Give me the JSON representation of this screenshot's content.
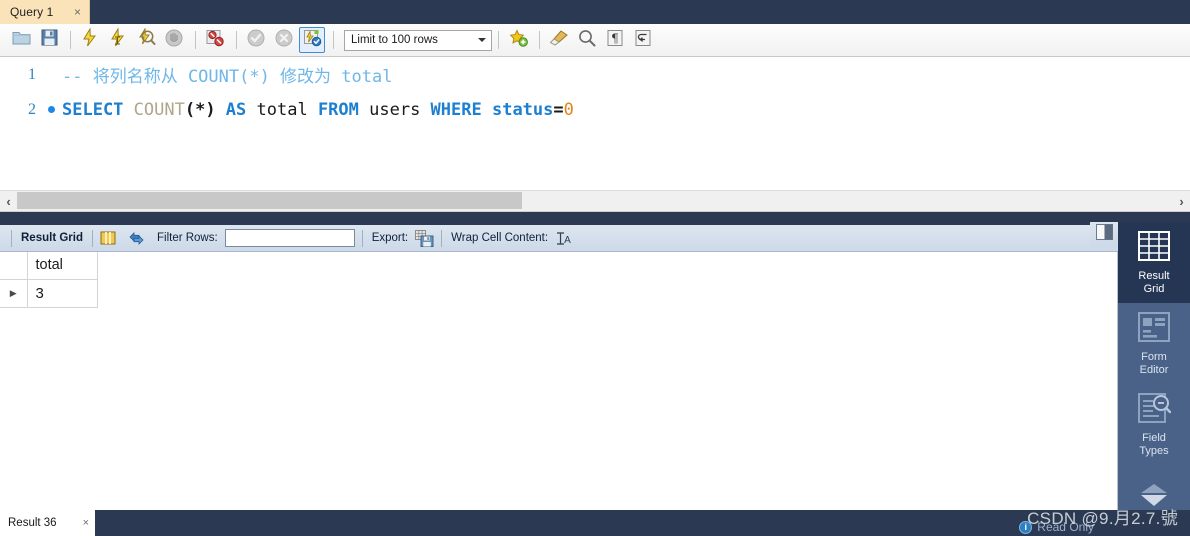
{
  "window": {
    "title": "Query 1"
  },
  "tabbar": {
    "tabs": [
      {
        "label": "Query 1",
        "close": "×",
        "active": true
      }
    ]
  },
  "toolbar": {
    "buttons": [
      {
        "name": "open-script-icon",
        "title": "Open SQL Script"
      },
      {
        "name": "save-script-icon",
        "title": "Save SQL Script"
      },
      {
        "name": "execute-statement-icon",
        "title": "Execute"
      },
      {
        "name": "execute-current-statement-icon",
        "title": "Execute Current Statement"
      },
      {
        "name": "explain-query-icon",
        "title": "Explain Current Statement"
      },
      {
        "name": "stop-execution-icon",
        "title": "Stop"
      },
      {
        "name": "toggle-stop-on-error-icon",
        "title": "Toggle whether execution should stop on error"
      },
      {
        "name": "commit-icon",
        "title": "Commit"
      },
      {
        "name": "rollback-icon",
        "title": "Rollback"
      },
      {
        "name": "autocommit-icon",
        "title": "Toggle Autocommit"
      },
      {
        "name": "add-snippet-icon",
        "title": "Save snippet"
      },
      {
        "name": "beautify-sql-icon",
        "title": "Beautify SQL"
      },
      {
        "name": "find-icon",
        "title": "Find"
      },
      {
        "name": "toggle-invisible-chars-icon",
        "title": "Toggle invisible characters"
      },
      {
        "name": "toggle-wrapping-icon",
        "title": "Toggle wrapping"
      }
    ],
    "limit_select": {
      "value": "Limit to 100 rows",
      "arrow": "▼"
    }
  },
  "editor": {
    "lines": [
      {
        "number": "1",
        "has_bullet": false,
        "tokens": [
          {
            "text": "-- 将列名称从 COUNT(*) 修改为 total",
            "cls": "c-comment"
          }
        ]
      },
      {
        "number": "2",
        "has_bullet": true,
        "tokens": [
          {
            "text": "SELECT ",
            "cls": "c-kw"
          },
          {
            "text": "COUNT",
            "cls": "c-fn"
          },
          {
            "text": "(*)",
            "cls": "c-op"
          },
          {
            "text": " AS ",
            "cls": "c-kw"
          },
          {
            "text": "total ",
            "cls": "c-plain"
          },
          {
            "text": "FROM ",
            "cls": "c-kw"
          },
          {
            "text": "users ",
            "cls": "c-plain"
          },
          {
            "text": "WHERE ",
            "cls": "c-kw"
          },
          {
            "text": "status",
            "cls": "c-kw"
          },
          {
            "text": "=",
            "cls": "c-op"
          },
          {
            "text": "0",
            "cls": "c-num"
          }
        ]
      }
    ],
    "full_text_line1": "-- 将列名称从 COUNT(*) 修改为 total",
    "full_text_line2": "SELECT COUNT(*) AS total FROM users WHERE status=0"
  },
  "hscroll": {
    "left_arrow": "‹",
    "right_arrow": "›"
  },
  "result_toolbar": {
    "result_grid_label": "Result Grid",
    "grid_icon": "grid-columns-icon",
    "refresh_icon": "refresh-icon",
    "filter_label": "Filter Rows:",
    "filter_value": "",
    "filter_placeholder": "",
    "export_label": "Export:",
    "export_icon": "export-recordset-icon",
    "wrap_label": "Wrap Cell Content:",
    "wrap_icon": "wrap-cell-icon"
  },
  "result_grid": {
    "columns": [
      "total"
    ],
    "rows": [
      {
        "marker": "▶",
        "cells": [
          "3"
        ]
      }
    ]
  },
  "side_panel": {
    "toggle_icon": "toggle-sidebar-icon",
    "items": [
      {
        "label_line1": "Result",
        "label_line2": "Grid",
        "icon": "result-grid-icon",
        "active": true
      },
      {
        "label_line1": "Form",
        "label_line2": "Editor",
        "icon": "form-editor-icon",
        "active": false
      },
      {
        "label_line1": "Field",
        "label_line2": "Types",
        "icon": "field-types-icon",
        "active": false
      }
    ],
    "scroll_up": "▲",
    "scroll_down": "▼"
  },
  "bottom": {
    "tabs": [
      {
        "label": "Result 36",
        "close": "×"
      }
    ],
    "readonly_label": "Read Only",
    "readonly_icon": "info-icon",
    "watermark": "CSDN @9.月2.7.號"
  },
  "colors": {
    "chrome_dark": "#2b3a52",
    "tab_active": "#fbe3b9",
    "accent_blue": "#1d7fd1",
    "comment_blue": "#6fb7e8",
    "number_orange": "#e0861a",
    "sidebar_blue": "#4a6288",
    "sidebar_active": "#253554",
    "result_toolbar": "#cdd9e8"
  }
}
